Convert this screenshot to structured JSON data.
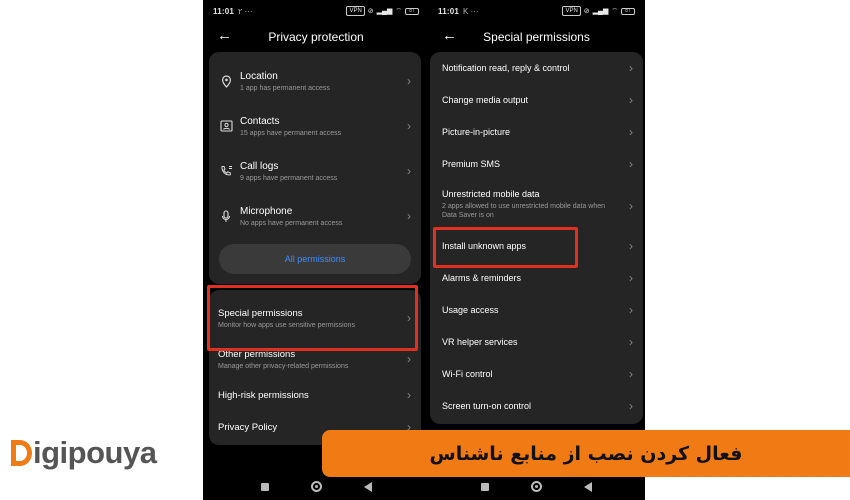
{
  "left_phone": {
    "status": {
      "time": "11:01",
      "notif": "۲ ···",
      "chips": [
        "VPN",
        "4G"
      ],
      "battery": "87"
    },
    "title": "Privacy protection",
    "permissions": [
      {
        "label": "Location",
        "sub": "1 app has permanent access",
        "icon": "location-pin-icon"
      },
      {
        "label": "Contacts",
        "sub": "15 apps have permanent access",
        "icon": "contacts-icon"
      },
      {
        "label": "Call logs",
        "sub": "9 apps have permanent access",
        "icon": "call-log-icon"
      },
      {
        "label": "Microphone",
        "sub": "No apps have permanent access",
        "icon": "microphone-icon"
      }
    ],
    "all_permissions": "All permissions",
    "special": {
      "label": "Special permissions",
      "sub": "Monitor how apps use sensitive permissions"
    },
    "other": {
      "label": "Other permissions",
      "sub": "Manage other privacy-related permissions"
    },
    "high_risk": "High-risk permissions",
    "privacy_policy": "Privacy Policy"
  },
  "right_phone": {
    "status": {
      "time": "11:01",
      "notif": "K ···",
      "chips": [
        "VPN",
        "4G"
      ],
      "battery": "87"
    },
    "title": "Special permissions",
    "items": [
      {
        "label": "Notification read, reply & control"
      },
      {
        "label": "Change media output"
      },
      {
        "label": "Picture-in-picture"
      },
      {
        "label": "Premium SMS"
      },
      {
        "label": "Unrestricted mobile data",
        "sub": "2 apps allowed to use unrestricted mobile data when Data Saver is on"
      },
      {
        "label": "Install unknown apps"
      },
      {
        "label": "Alarms & reminders"
      },
      {
        "label": "Usage access"
      },
      {
        "label": "VR helper services"
      },
      {
        "label": "Wi-Fi control"
      },
      {
        "label": "Screen turn-on control"
      }
    ]
  },
  "brand": {
    "logo_text": "igipouya",
    "orange": "#f07a14",
    "highlight": "#e03020"
  },
  "banner": {
    "text": "فعال کردن نصب از منابع ناشناس"
  }
}
